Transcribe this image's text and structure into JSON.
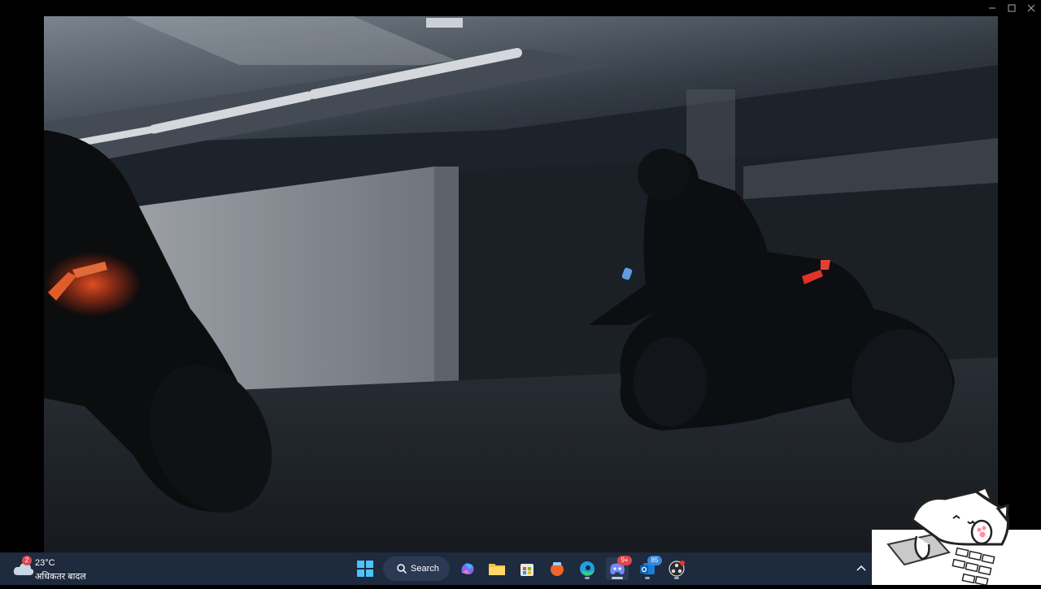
{
  "window": {
    "minimize_icon": "minimize-icon",
    "maximize_icon": "maximize-icon",
    "close_icon": "close-icon"
  },
  "video": {
    "description_icon": "video-frame"
  },
  "taskbar": {
    "weather": {
      "temp": "23°C",
      "condition": "अधिकतर बादल",
      "badge": "2"
    },
    "search_label": "Search",
    "apps": [
      {
        "name": "start",
        "icon": "windows-logo-icon"
      },
      {
        "name": "copilot",
        "icon": "copilot-icon"
      },
      {
        "name": "file-explorer",
        "icon": "folder-icon"
      },
      {
        "name": "microsoft-store",
        "icon": "store-icon"
      },
      {
        "name": "app-orange",
        "icon": "orange-app-icon"
      },
      {
        "name": "edge",
        "icon": "edge-icon"
      },
      {
        "name": "discord",
        "icon": "discord-icon",
        "badge": "9+"
      },
      {
        "name": "outlook",
        "icon": "outlook-icon",
        "badge": "85"
      },
      {
        "name": "obs",
        "icon": "obs-icon"
      }
    ],
    "accent": "#1e2a3e"
  }
}
